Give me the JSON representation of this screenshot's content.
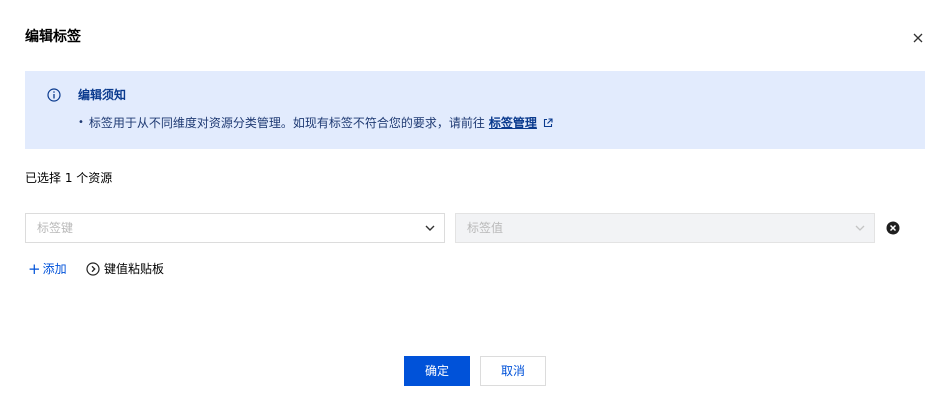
{
  "dialog": {
    "title": "编辑标签",
    "close_icon": "close-icon"
  },
  "notice": {
    "icon": "info-icon",
    "title": "编辑须知",
    "bullet": "•",
    "text": "标签用于从不同维度对资源分类管理。如现有标签不符合您的要求，请前往",
    "link_label": "标签管理",
    "link_icon": "external-link-icon"
  },
  "selection": {
    "summary": "已选择 1 个资源"
  },
  "tag_row": {
    "key_placeholder": "标签键",
    "value_placeholder": "标签值",
    "remove_icon": "remove-circle-icon"
  },
  "actions": {
    "add_icon": "+",
    "add_label": "添加",
    "clipboard_label": "键值粘贴板"
  },
  "footer": {
    "confirm_label": "确定",
    "cancel_label": "取消"
  },
  "colors": {
    "primary": "#0052d9",
    "notice_bg": "#e2ebfd"
  }
}
